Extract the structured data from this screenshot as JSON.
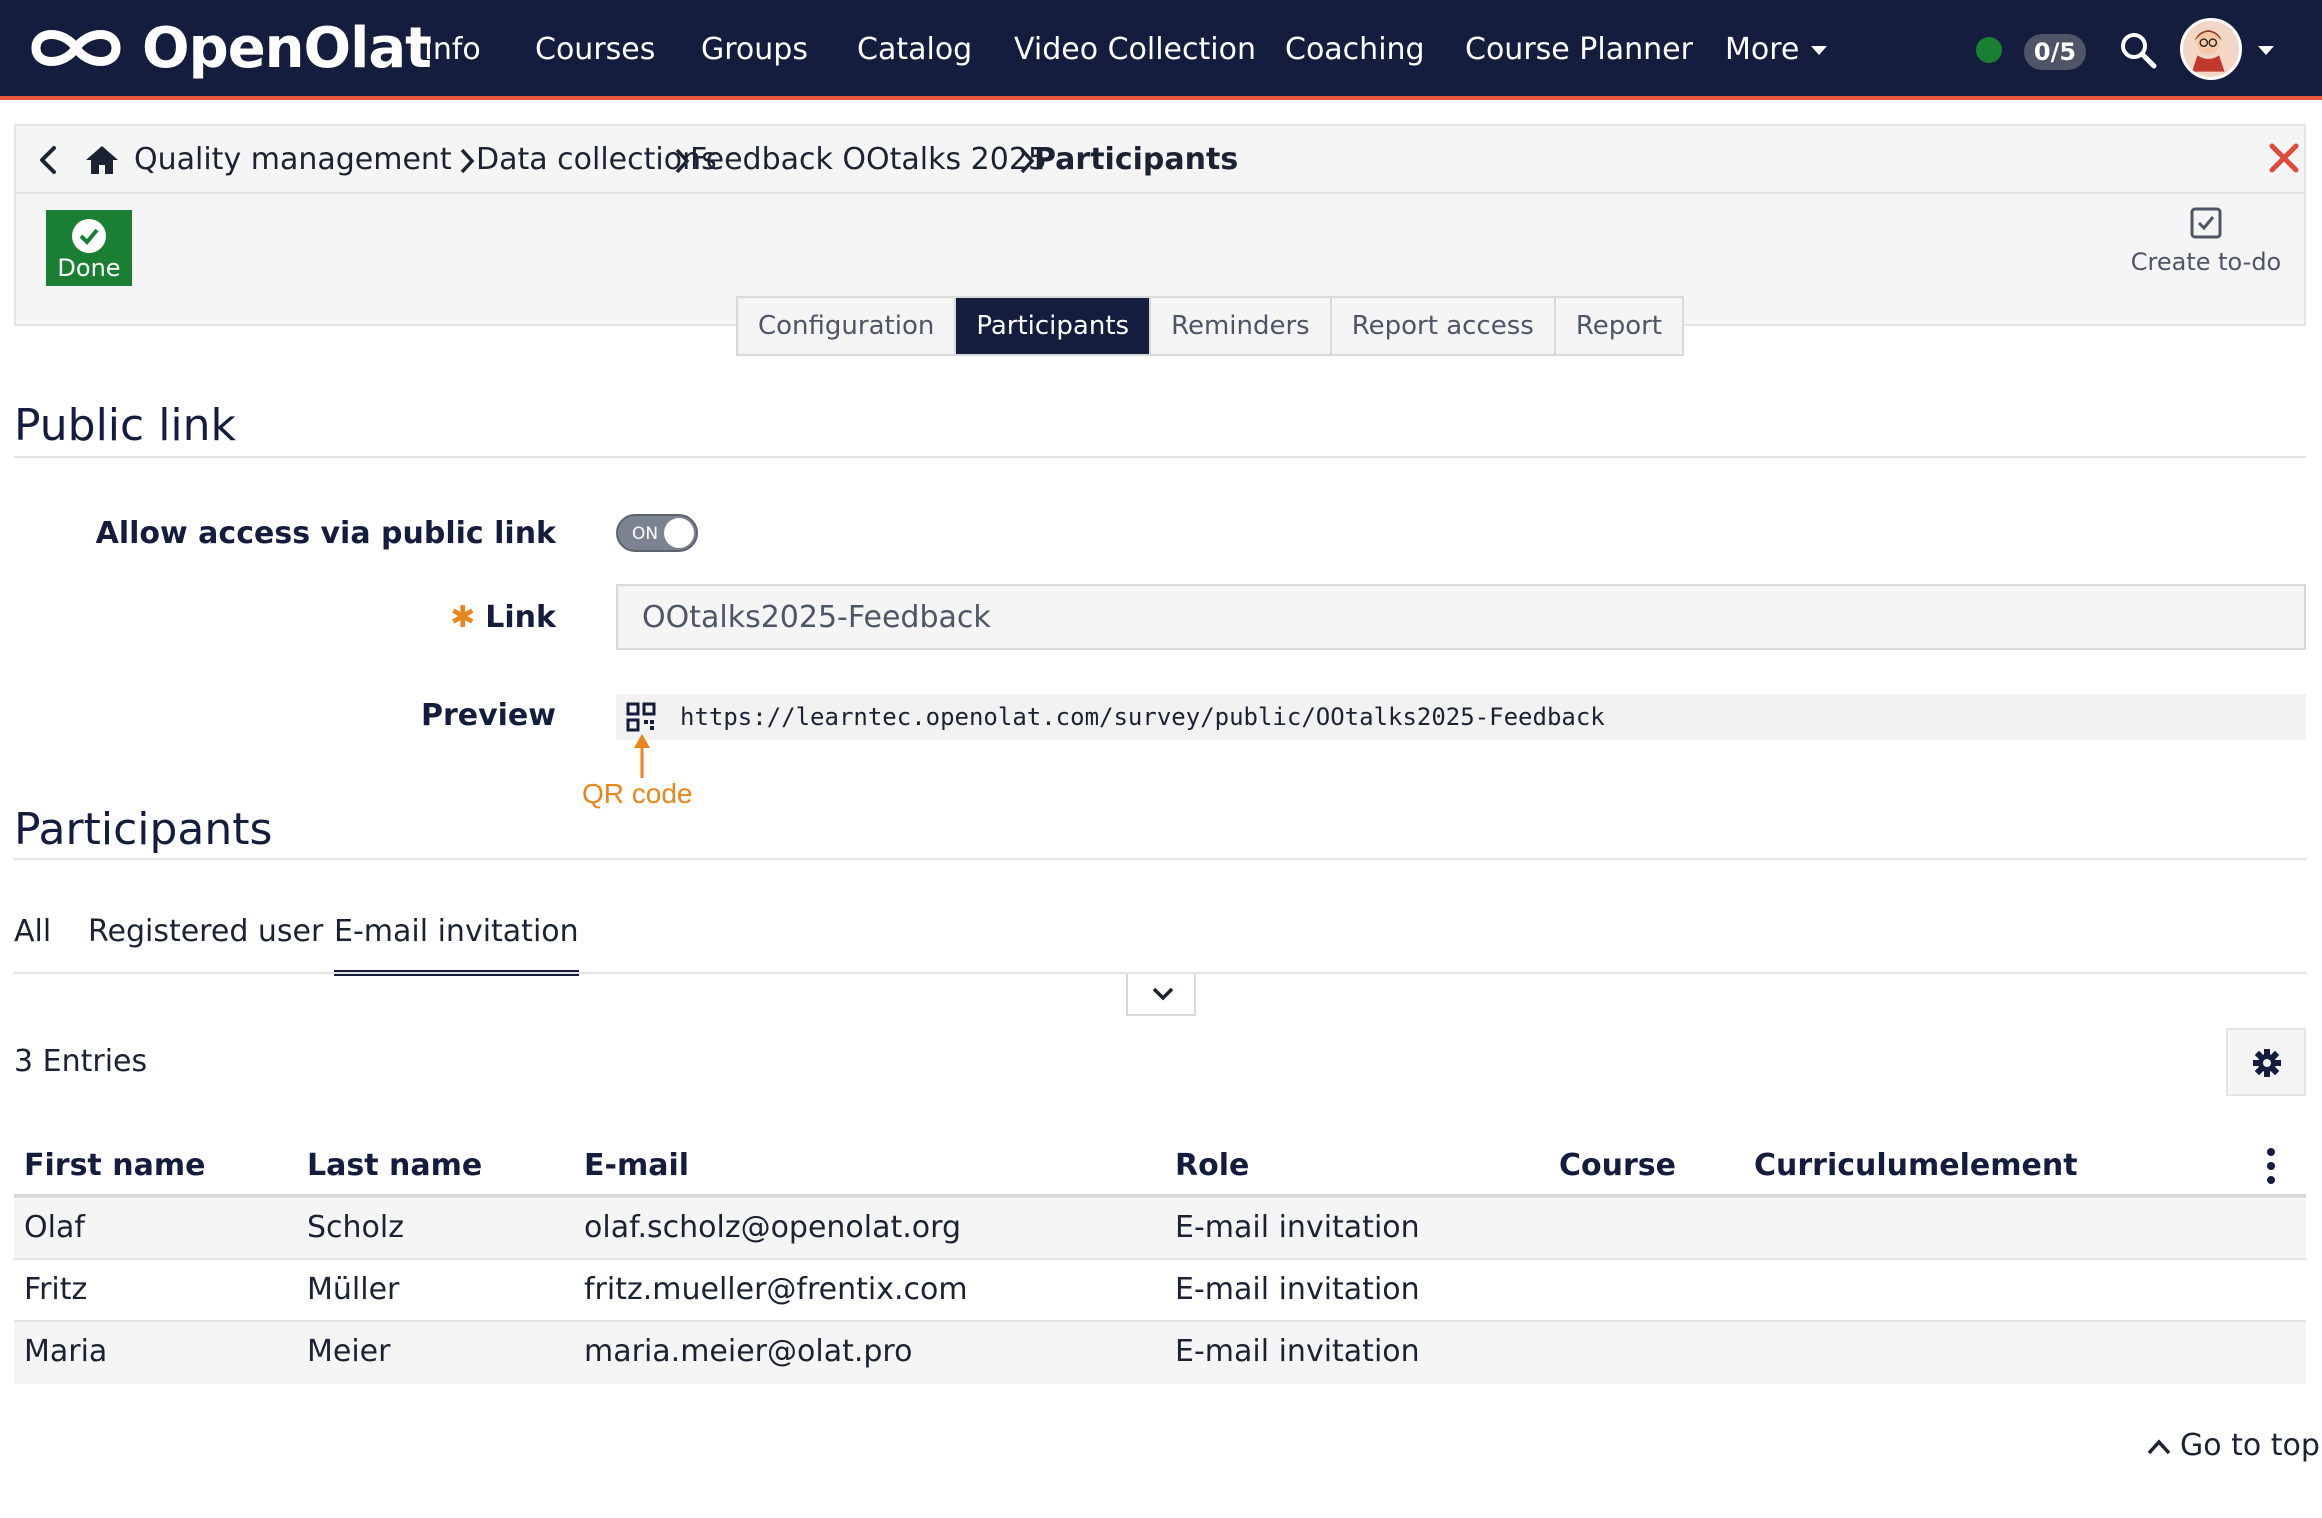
{
  "navbar": {
    "brand": "OpenOlat",
    "items": [
      "Info",
      "Courses",
      "Groups",
      "Catalog",
      "Video Collection",
      "Coaching",
      "Course Planner",
      "More"
    ],
    "badge": "0/5",
    "status_color": "#1a7f33",
    "accent_color": "#e8583c"
  },
  "breadcrumb": {
    "items": [
      "Quality management",
      "Data collections",
      "Feedback OOtalks 2025",
      "Participants"
    ]
  },
  "toolbar": {
    "done_label": "Done",
    "todo_label": "Create to-do"
  },
  "tabs": [
    "Configuration",
    "Participants",
    "Reminders",
    "Report access",
    "Report"
  ],
  "active_tab": "Participants",
  "public_link": {
    "title": "Public link",
    "allow_label": "Allow access via public link",
    "toggle_state": "ON",
    "link_label": "Link",
    "link_value": "OOtalks2025-Feedback",
    "preview_label": "Preview",
    "preview_url": "https://learntec.openolat.com/survey/public/OOtalks2025-Feedback",
    "qr_annotation": "QR code"
  },
  "participants": {
    "title": "Participants",
    "subtabs": [
      "All",
      "Registered user",
      "E-mail invitation"
    ],
    "active_subtab": "E-mail invitation",
    "entries": "3 Entries",
    "columns": [
      "First name",
      "Last name",
      "E-mail",
      "Role",
      "Course",
      "Curriculumelement"
    ],
    "rows": [
      [
        "Olaf",
        "Scholz",
        "olaf.scholz@openolat.org",
        "E-mail invitation",
        "",
        ""
      ],
      [
        "Fritz",
        "Müller",
        "fritz.mueller@frentix.com",
        "E-mail invitation",
        "",
        ""
      ],
      [
        "Maria",
        "Meier",
        "maria.meier@olat.pro",
        "E-mail invitation",
        "",
        ""
      ]
    ]
  },
  "footer": {
    "go_top": "Go to top"
  }
}
